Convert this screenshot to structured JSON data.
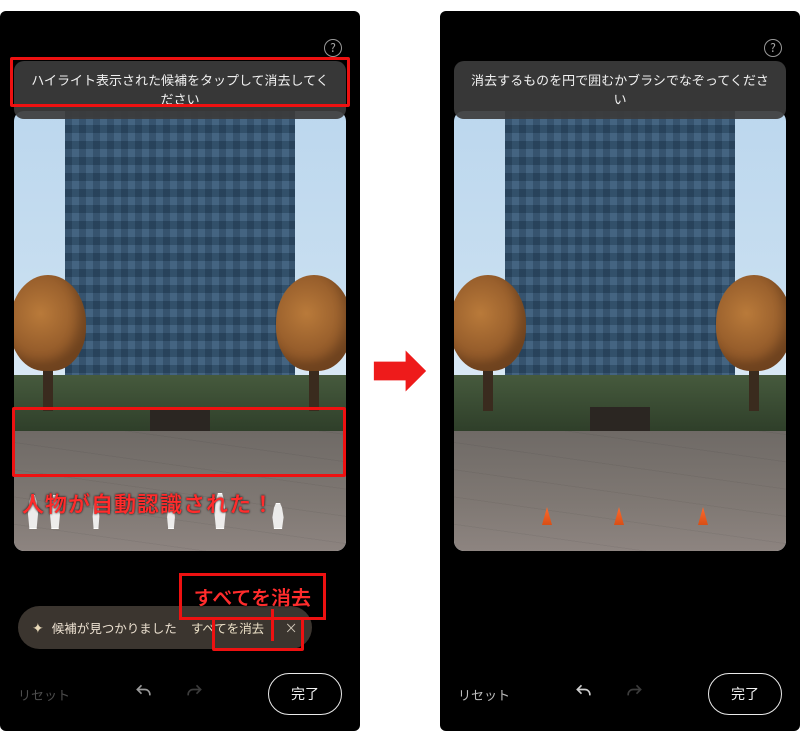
{
  "annotation_color": "#ee1111",
  "left": {
    "help_glyph": "?",
    "hint": "ハイライト表示された候補をタップして消去してください",
    "people_detected": 6,
    "annotation_auto_detect": "人物が自動認識された！",
    "annotation_erase_all": "すべてを消去",
    "snackbar": {
      "message": "候補が見つかりました",
      "action": "すべてを消去",
      "close_glyph": "×"
    },
    "bottom": {
      "reset": "リセット",
      "done": "完了"
    }
  },
  "right": {
    "help_glyph": "?",
    "hint": "消去するものを円で囲むかブラシでなぞってください",
    "bottom": {
      "reset": "リセット",
      "done": "完了"
    }
  }
}
